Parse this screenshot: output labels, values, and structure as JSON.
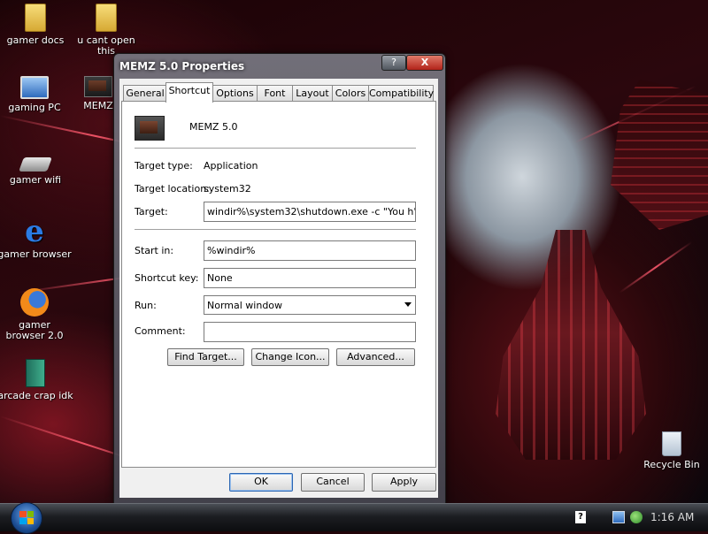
{
  "desktop": {
    "icons": [
      {
        "label": "gamer docs"
      },
      {
        "label": "u cant open this"
      },
      {
        "label": "gaming PC"
      },
      {
        "label": "MEMZ"
      },
      {
        "label": "gamer wifi"
      },
      {
        "label": "gamer browser"
      },
      {
        "label": "gamer browser 2.0"
      },
      {
        "label": "arcade crap idk"
      },
      {
        "label": "Recycle Bin"
      }
    ]
  },
  "dialog": {
    "title": "MEMZ 5.0 Properties",
    "help_label": "?",
    "close_label": "X",
    "tabs": [
      "General",
      "Shortcut",
      "Options",
      "Font",
      "Layout",
      "Colors",
      "Compatibility"
    ],
    "active_tab": "Shortcut",
    "app_name": "MEMZ 5.0",
    "target_type_label": "Target type:",
    "target_type_value": "Application",
    "target_location_label": "Target location:",
    "target_location_value": "system32",
    "target_label": "Target:",
    "target_value": "windir%\\system32\\shutdown.exe -c \"You h\"",
    "start_in_label": "Start in:",
    "start_in_value": "%windir%",
    "shortcut_key_label": "Shortcut key:",
    "shortcut_key_value": "None",
    "run_label": "Run:",
    "run_value": "Normal window",
    "comment_label": "Comment:",
    "comment_value": "",
    "buttons": {
      "find_target": "Find Target...",
      "change_icon": "Change Icon...",
      "advanced": "Advanced...",
      "ok": "OK",
      "cancel": "Cancel",
      "apply": "Apply"
    }
  },
  "taskbar": {
    "clock": "1:16 AM",
    "tray_help": "?"
  },
  "colors": {
    "dialog_glass": "#5a5a64",
    "accent_default_button": "#2b66b3",
    "taskbar": "#1c1e22"
  }
}
